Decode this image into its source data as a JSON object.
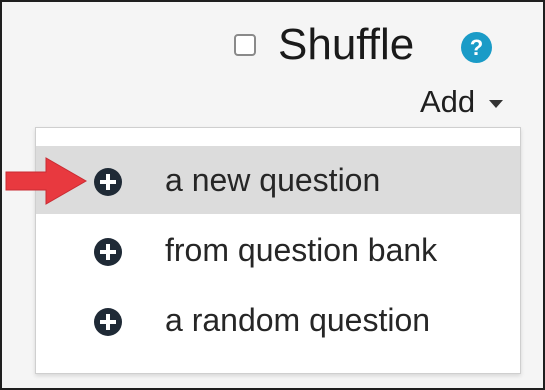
{
  "header": {
    "shuffle_label": "Shuffle",
    "shuffle_checked": false,
    "help_icon": "question-mark-icon",
    "help_symbol": "?",
    "add_label": "Add"
  },
  "add_menu": {
    "items": [
      {
        "label": "a new question",
        "icon": "plus-circle-icon",
        "highlighted": true
      },
      {
        "label": "from question bank",
        "icon": "plus-circle-icon",
        "highlighted": false
      },
      {
        "label": "a random question",
        "icon": "plus-circle-icon",
        "highlighted": false
      }
    ]
  },
  "annotation": {
    "icon": "red-arrow-icon",
    "color": "#e8393f"
  },
  "colors": {
    "help_icon": "#1a9bc7",
    "highlight_row": "#dcdcdc",
    "plus_icon": "#1f2a36"
  }
}
